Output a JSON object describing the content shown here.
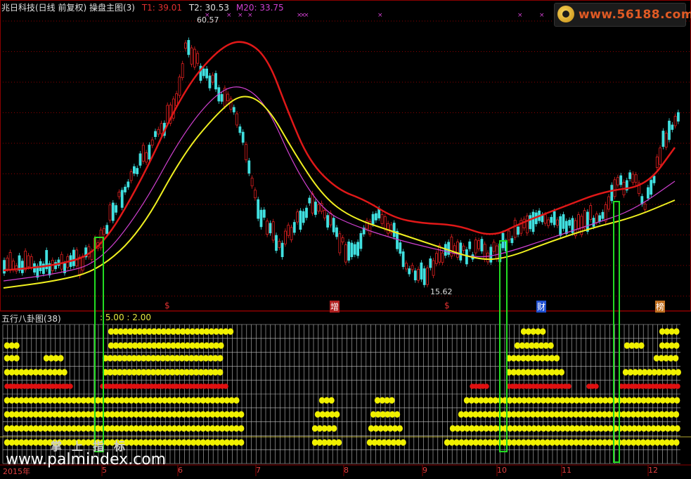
{
  "header": {
    "title": "兆日科技(日线 前复权) 操盘主图(3)",
    "t1": "T1: 39.01",
    "t2": "T2: 30.53",
    "m20": "M20: 33.75"
  },
  "sub_panel": {
    "title": "五行八卦图(38)",
    "values": ": 5.00 : 2.00"
  },
  "logo": {
    "text": "www.56188.com"
  },
  "watermark": {
    "cn": "掌上指标",
    "url": "www.palmindex.com"
  },
  "annotations": {
    "high": "60.57",
    "low": "15.62",
    "markers": [
      "$",
      "增",
      "$",
      "财",
      "榜"
    ]
  },
  "axis": {
    "labels": [
      "2015年",
      "5",
      "6",
      "7",
      "8",
      "9",
      "10",
      "11",
      "12"
    ]
  },
  "colors": {
    "red_line": "#e01818",
    "magenta_line": "#d040d0",
    "yellow_line": "#f0f020",
    "up_candle": "#e02020",
    "down_candle": "#40e0e0",
    "grid": "#8c0000",
    "dots_yellow": "#f0f000",
    "dots_red": "#e01010",
    "highlight_box": "#22dd22"
  }
}
